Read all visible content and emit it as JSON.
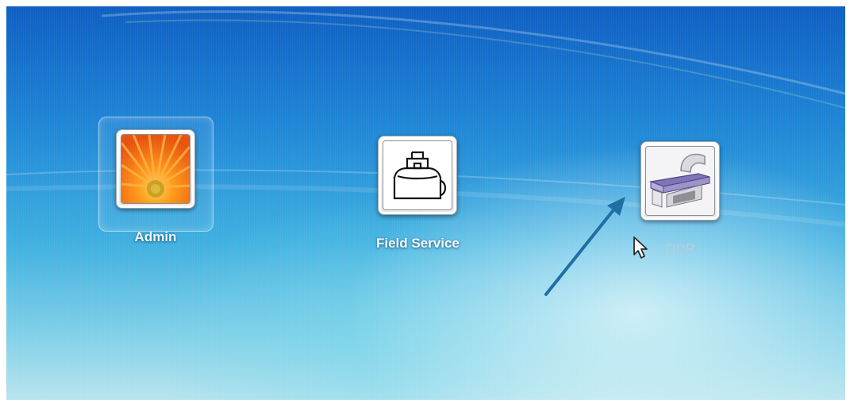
{
  "desktop": {
    "accounts": [
      {
        "label": "Admin",
        "icon": "flower-icon"
      },
      {
        "label": "Field Service",
        "icon": "toolbag-icon"
      },
      {
        "label": "QDR",
        "icon": "bone-densitometer-icon"
      }
    ]
  },
  "colors": {
    "annotation_arrow": "#1f6fa3",
    "label_text": "#f4f8fb"
  }
}
